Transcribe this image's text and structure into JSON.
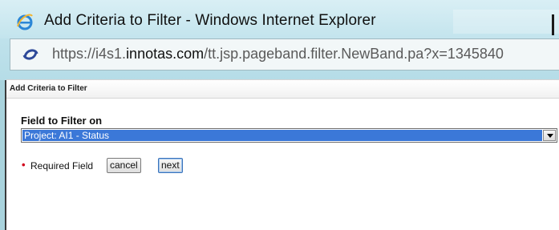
{
  "window": {
    "title": "Add Criteria to Filter - Windows Internet Explorer",
    "url_prefix": "https://i4s1.",
    "url_host": "innotas.com",
    "url_path": "/tt.jsp.pageband.filter.NewBand.pa?x=1345840"
  },
  "page": {
    "header": "Add Criteria to Filter",
    "field_label": "Field to Filter on",
    "selected_field": "Project: AI1 - Status",
    "required_marker": "•",
    "required_text": "Required Field",
    "cancel_label": "cancel",
    "next_label": "next"
  },
  "icons": {
    "browser": "internet-explorer-icon",
    "page": "page-loading-icon",
    "dropdown": "chevron-down-icon"
  },
  "colors": {
    "selection": "#3b78d8",
    "required": "#d0021b",
    "frame": "#b3dbe6"
  }
}
